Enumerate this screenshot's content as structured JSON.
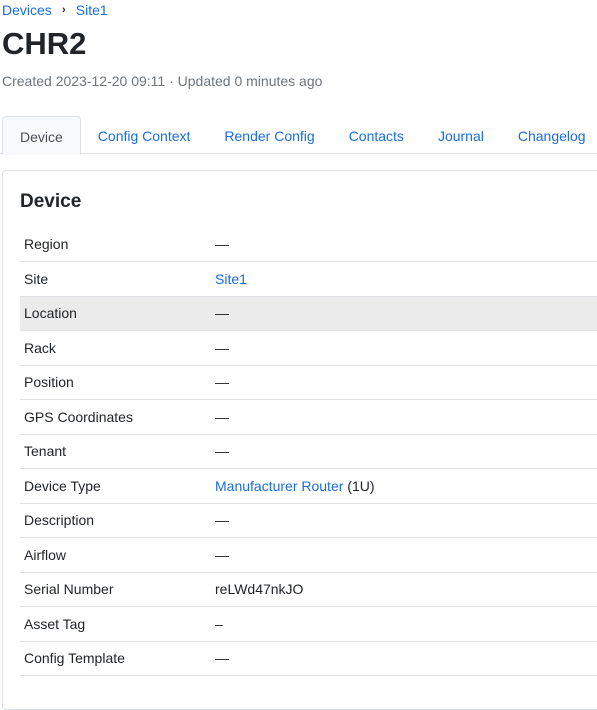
{
  "breadcrumb": {
    "items": [
      {
        "label": "Devices"
      },
      {
        "label": "Site1"
      }
    ],
    "separator": "›"
  },
  "page": {
    "title": "CHR2",
    "meta": "Created 2023-12-20 09:11 · Updated 0 minutes ago"
  },
  "tabs": [
    {
      "label": "Device",
      "active": true
    },
    {
      "label": "Config Context",
      "active": false
    },
    {
      "label": "Render Config",
      "active": false
    },
    {
      "label": "Contacts",
      "active": false
    },
    {
      "label": "Journal",
      "active": false
    },
    {
      "label": "Changelog",
      "active": false
    }
  ],
  "card": {
    "title": "Device",
    "rows": [
      {
        "label": "Region",
        "value": "—"
      },
      {
        "label": "Site",
        "value": "Site1"
      },
      {
        "label": "Location",
        "value": "—"
      },
      {
        "label": "Rack",
        "value": "—"
      },
      {
        "label": "Position",
        "value": "—"
      },
      {
        "label": "GPS Coordinates",
        "value": "—"
      },
      {
        "label": "Tenant",
        "value": "—"
      },
      {
        "label": "Device Type",
        "value": "Manufacturer Router",
        "suffix": "(1U)"
      },
      {
        "label": "Description",
        "value": "—"
      },
      {
        "label": "Airflow",
        "value": "—"
      },
      {
        "label": "Serial Number",
        "value": "reLWd47nkJO"
      },
      {
        "label": "Asset Tag",
        "value": "–"
      },
      {
        "label": "Config Template",
        "value": "—"
      }
    ]
  },
  "colors": {
    "link": "#1a6ed8",
    "text": "#212529",
    "muted": "#6c757d",
    "border": "#dee2e6",
    "row_hover": "#ebebeb"
  }
}
